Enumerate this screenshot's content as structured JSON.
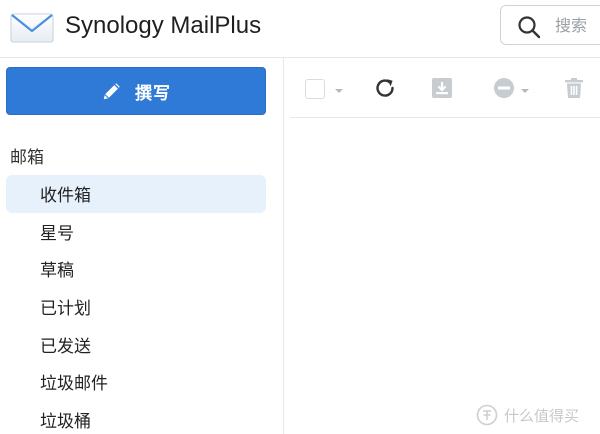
{
  "app": {
    "title": "Synology MailPlus"
  },
  "search": {
    "placeholder": "搜索"
  },
  "sidebar": {
    "compose_label": "撰写",
    "section_label": "邮箱",
    "items": [
      {
        "label": "收件箱",
        "active": true
      },
      {
        "label": "星号",
        "active": false
      },
      {
        "label": "草稿",
        "active": false
      },
      {
        "label": "已计划",
        "active": false
      },
      {
        "label": "已发送",
        "active": false
      },
      {
        "label": "垃圾邮件",
        "active": false
      },
      {
        "label": "垃圾桶",
        "active": false
      }
    ]
  },
  "toolbar": {
    "icons": [
      "checkbox-icon",
      "refresh-icon",
      "archive-icon",
      "block-icon",
      "trash-icon"
    ]
  },
  "colors": {
    "accent": "#2f7ad6",
    "active_item_bg": "#e7f1fb",
    "disabled_icon": "#c7ccd1"
  },
  "watermark": {
    "text": "什么值得买"
  }
}
